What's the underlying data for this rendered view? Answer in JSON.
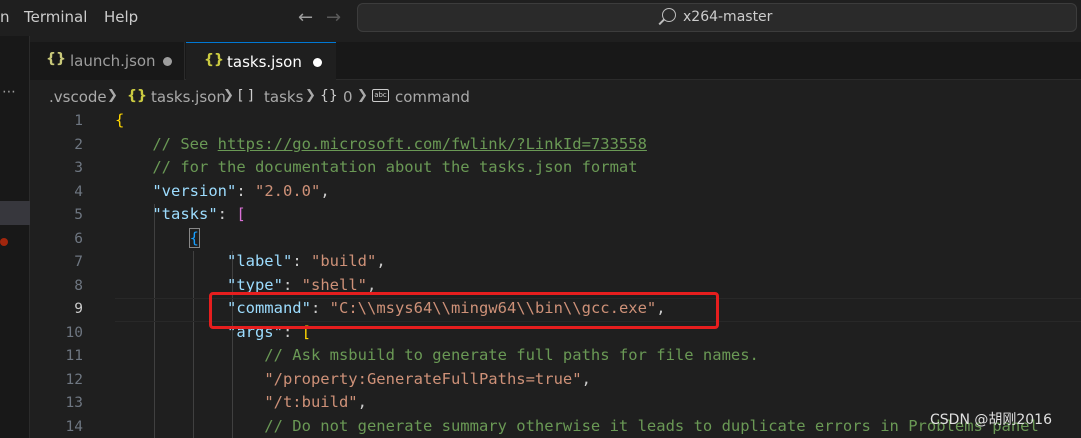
{
  "menu": {
    "partial_item": "n",
    "items": [
      "Terminal",
      "Help"
    ]
  },
  "command_center": {
    "text": "x264-master"
  },
  "tabs": [
    {
      "label": "launch.json",
      "icon": "{}",
      "active": false
    },
    {
      "label": "tasks.json",
      "icon": "{}",
      "active": true
    }
  ],
  "breadcrumb": {
    "folder": ".vscode",
    "file": "tasks.json",
    "tasks_label": "tasks",
    "index_label": "0",
    "command_label": "command",
    "brackets_icon": "[ ]",
    "braces_icon": "{}",
    "string_icon": "abc"
  },
  "editor": {
    "current_line": 9,
    "lines": [
      {
        "n": "1",
        "tokens": [
          [
            "t-brace",
            "{"
          ]
        ]
      },
      {
        "n": "2",
        "tokens": [
          [
            "t-comment",
            "    // See "
          ],
          [
            "t-link",
            "https://go.microsoft.com/fwlink/?LinkId=733558"
          ]
        ]
      },
      {
        "n": "3",
        "tokens": [
          [
            "t-comment",
            "    // for the documentation about the tasks.json format"
          ]
        ]
      },
      {
        "n": "4",
        "tokens": [
          [
            "t-punc",
            "    "
          ],
          [
            "t-key",
            "\"version\""
          ],
          [
            "t-punc",
            ": "
          ],
          [
            "t-str",
            "\"2.0.0\""
          ],
          [
            "t-punc",
            ","
          ]
        ]
      },
      {
        "n": "5",
        "tokens": [
          [
            "t-punc",
            "    "
          ],
          [
            "t-key",
            "\"tasks\""
          ],
          [
            "t-punc",
            ": "
          ],
          [
            "t-bracket",
            "["
          ]
        ]
      },
      {
        "n": "6",
        "tokens": [
          [
            "t-punc",
            "        "
          ],
          [
            "t-brace2 box-brace",
            "{"
          ]
        ]
      },
      {
        "n": "7",
        "tokens": [
          [
            "t-punc",
            "            "
          ],
          [
            "t-key",
            "\"label\""
          ],
          [
            "t-punc",
            ": "
          ],
          [
            "t-str",
            "\"build\""
          ],
          [
            "t-punc",
            ","
          ]
        ]
      },
      {
        "n": "8",
        "tokens": [
          [
            "t-punc",
            "            "
          ],
          [
            "t-key",
            "\"type\""
          ],
          [
            "t-punc",
            ": "
          ],
          [
            "t-str",
            "\"shell\""
          ],
          [
            "t-punc",
            ","
          ]
        ]
      },
      {
        "n": "9",
        "tokens": [
          [
            "t-punc",
            "            "
          ],
          [
            "t-key",
            "\"command\""
          ],
          [
            "t-punc",
            ": "
          ],
          [
            "t-str",
            "\"C:\\\\msys64\\\\mingw64\\\\bin\\\\gcc.exe\""
          ],
          [
            "t-punc",
            ","
          ]
        ]
      },
      {
        "n": "10",
        "tokens": [
          [
            "t-punc",
            "            "
          ],
          [
            "t-key",
            "\"args\""
          ],
          [
            "t-punc",
            ": "
          ],
          [
            "t-brace",
            "["
          ]
        ]
      },
      {
        "n": "11",
        "tokens": [
          [
            "t-comment",
            "                // Ask msbuild to generate full paths for file names."
          ]
        ]
      },
      {
        "n": "12",
        "tokens": [
          [
            "t-punc",
            "                "
          ],
          [
            "t-str",
            "\"/property:GenerateFullPaths=true\""
          ],
          [
            "t-punc",
            ","
          ]
        ]
      },
      {
        "n": "13",
        "tokens": [
          [
            "t-punc",
            "                "
          ],
          [
            "t-str",
            "\"/t:build\""
          ],
          [
            "t-punc",
            ","
          ]
        ]
      },
      {
        "n": "14",
        "tokens": [
          [
            "t-comment",
            "                // Do not generate summary otherwise it leads to duplicate errors in Problems panel"
          ]
        ]
      }
    ]
  },
  "watermark": "CSDN @胡刚2016",
  "colors": {
    "background": "#1f1f1f",
    "highlight_box": "#e61e1e",
    "comment": "#6a9955",
    "key": "#9cdcfe",
    "string": "#ce9178"
  }
}
